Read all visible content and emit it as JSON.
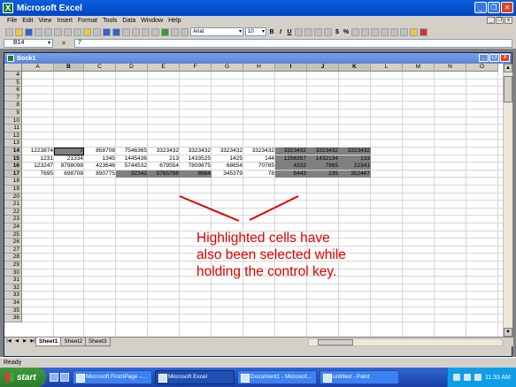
{
  "window": {
    "title": "Microsoft Excel",
    "app_icon": "excel-icon"
  },
  "menu": [
    "File",
    "Edit",
    "View",
    "Insert",
    "Format",
    "Tools",
    "Data",
    "Window",
    "Help"
  ],
  "toolbar": {
    "font": "Arial",
    "size": "10",
    "bold": "B",
    "italic": "I",
    "underline": "U",
    "currency": "$",
    "percent": "%"
  },
  "formula": {
    "cell": "B14",
    "fx": "=",
    "value": "7"
  },
  "workbook": {
    "title": "Book1"
  },
  "columns": [
    "A",
    "B",
    "C",
    "D",
    "E",
    "F",
    "G",
    "H",
    "I",
    "J",
    "K",
    "L",
    "M",
    "N",
    "O"
  ],
  "rows_top": [
    "4",
    "5",
    "6",
    "7",
    "8",
    "9",
    "10",
    "11",
    "12",
    "13"
  ],
  "data_rows": [
    {
      "num": "14",
      "cells": [
        "1223874",
        "7",
        "858708",
        "7546365",
        "3323432",
        "3323432",
        "3323432",
        "3323432",
        "3323432",
        "3323432",
        "3323432"
      ]
    },
    {
      "num": "15",
      "cells": [
        "1231",
        "21334",
        "1345",
        "1445436",
        "213",
        "1433525",
        "1425",
        "144",
        "1256357",
        "1432134",
        "133"
      ]
    },
    {
      "num": "16",
      "cells": [
        "123247",
        "8798098",
        "423646",
        "5744532",
        "679554",
        "7809875",
        "68654",
        "70785",
        "4332",
        "7965",
        "22341"
      ]
    },
    {
      "num": "17",
      "cells": [
        "7695",
        "698708",
        "890775",
        "32342",
        "5765798",
        "8664",
        "345379",
        "78",
        "5443",
        "235",
        "352467"
      ]
    }
  ],
  "rows_bottom": [
    "18",
    "19",
    "20",
    "21",
    "22",
    "23",
    "24",
    "25",
    "26",
    "27",
    "28",
    "29",
    "30",
    "31",
    "32",
    "33",
    "34",
    "35",
    "36"
  ],
  "sheets": [
    "Sheet1",
    "Sheet2",
    "Sheet3"
  ],
  "status": "Ready",
  "annotation": [
    "Highlighted cells have",
    "also been selected while",
    "holding the control key."
  ],
  "taskbar": {
    "start": "start",
    "tasks": [
      "Microsoft FrontPage -...",
      "Microsoft Excel",
      "Document1 - Microsof...",
      "untitled - Paint"
    ],
    "clock": "11:33 AM"
  },
  "colors": {
    "selection": "#808080",
    "annotation": "#e00000",
    "title": "#0a5fd8"
  }
}
